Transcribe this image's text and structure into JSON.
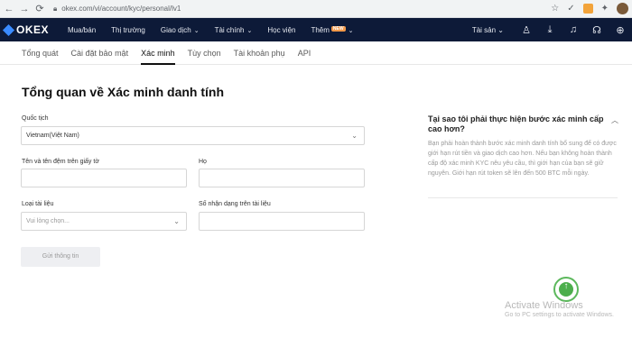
{
  "browser": {
    "back_icon": "arrow-left-icon",
    "forward_icon": "arrow-right-icon",
    "reload_icon": "reload-icon",
    "url": "okex.com/vi/account/kyc/personal/lv1"
  },
  "topnav": {
    "logo_text": "OKEX",
    "items": [
      {
        "label": "Mua/bán"
      },
      {
        "label": "Thị trường"
      },
      {
        "label": "Giao dịch"
      },
      {
        "label": "Tài chính"
      },
      {
        "label": "Học viện"
      },
      {
        "label": "Thêm",
        "badge": "NEW"
      }
    ],
    "assets_label": "Tài sản"
  },
  "subnav": {
    "tabs": [
      {
        "label": "Tổng quát"
      },
      {
        "label": "Cài đặt bảo mật"
      },
      {
        "label": "Xác minh",
        "active": true
      },
      {
        "label": "Tùy chọn"
      },
      {
        "label": "Tài khoản phụ"
      },
      {
        "label": "API"
      }
    ]
  },
  "form": {
    "title": "Tổng quan về Xác minh danh tính",
    "country_label": "Quốc tịch",
    "country_value": "Vietnam(Việt Nam)",
    "given_name_label": "Tên và tên đệm trên giấy tờ",
    "surname_label": "Họ",
    "doc_type_label": "Loại tài liệu",
    "doc_type_placeholder": "Vui lòng chọn...",
    "doc_number_label": "Số nhận dạng trên tài liệu",
    "submit_label": "Gửi thông tin"
  },
  "faq": {
    "title": "Tại sao tôi phải thực hiện bước xác minh cấp cao hơn?",
    "body": "Bạn phải hoàn thành bước xác minh danh tính bổ sung để có được giới hạn rút tiền và giao dịch cao hơn. Nếu bạn không hoàn thành cấp độ xác minh KYC nêu yêu cầu, thì giới hạn của bạn sẽ giữ nguyên. Giới hạn rút token sẽ lên đến 500 BTC mỗi ngày."
  },
  "watermark": {
    "title": "Activate Windows",
    "subtitle": "Go to PC settings to activate Windows."
  },
  "colors": {
    "nav_bg": "#0d1a38",
    "logo_blue": "#3a8bff",
    "new_badge": "#f2994a"
  }
}
